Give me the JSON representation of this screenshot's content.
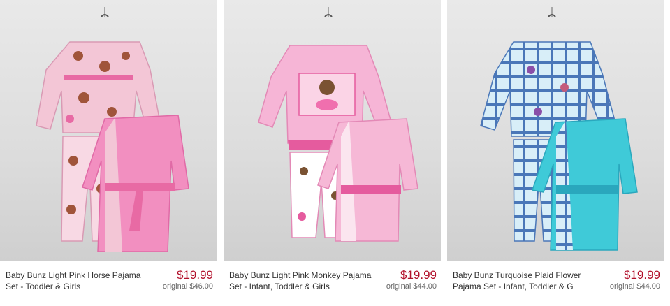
{
  "products": [
    {
      "title": "Baby Bunz Light Pink Horse Pajama Set - Toddler & Girls",
      "price": "$19.99",
      "original": "original $46.00",
      "image_icon": "pajama-set-image",
      "colors": {
        "pajama": "#f3c6d6",
        "pattern": "#a0543a",
        "robe": "#f28fc0",
        "trim": "#e86aa4"
      }
    },
    {
      "title": "Baby Bunz Light Pink Monkey Pajama Set - Infant, Toddler & Girls",
      "price": "$19.99",
      "original": "original $44.00",
      "image_icon": "pajama-set-image",
      "colors": {
        "pajama": "#f6b5d6",
        "pattern": "#7a5232",
        "robe": "#f6b8d6",
        "trim": "#e55b9e"
      }
    },
    {
      "title": "Baby Bunz Turquoise Plaid Flower Pajama Set - Infant, Toddler & G",
      "price": "$19.99",
      "original": "original $44.00",
      "image_icon": "pajama-set-image",
      "colors": {
        "pajama": "#8ec8e4",
        "pattern": "#4a77b8",
        "robe": "#3fcad8",
        "trim": "#2aa7bd"
      }
    }
  ]
}
